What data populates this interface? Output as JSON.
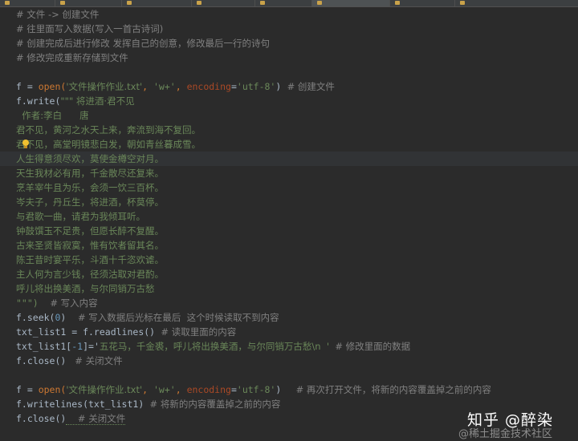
{
  "tabs": [
    "",
    "",
    "",
    "",
    "",
    "",
    "",
    ""
  ],
  "code": {
    "l1": "# 文件 -> 创建文件",
    "l2": "# 往里面写入数据(写入一首古诗词)",
    "l3": "# 创建完成后进行修改 发挥自己的创意，修改最后一行的诗句",
    "l4": "# 修改完成重新存储到文件",
    "l6_var": "f = ",
    "l6_open": "open(",
    "l6_s1": "'文件操作作业.txt'",
    "l6_comma1": ", ",
    "l6_s2": "'w+'",
    "l6_comma2": ", ",
    "l6_kw": "encoding",
    "l6_eq": "=",
    "l6_s3": "'utf-8'",
    "l6_close": ")",
    "l6_comment": "  # 创建文件",
    "l7_code": "f.write(",
    "l7_str": "\"\"\" 将进酒·君不见",
    "l8": "  作者:李白      唐",
    "l9": "君不见，黄河之水天上来，奔流到海不复回。",
    "l10": "君不见，高堂明镜悲白发，朝如青丝暮成雪。",
    "l11": "人生得意须尽欢，莫使金樽空对月。",
    "l12": "天生我材必有用，千金散尽还复来。",
    "l13": "烹羊宰牛且为乐，会须一饮三百杯。",
    "l14": "岑夫子，丹丘生，将进酒，杯莫停。",
    "l15": "与君歌一曲，请君为我倾耳听。",
    "l16": "钟鼓馔玉不足贵，但愿长醉不复醒。",
    "l17": "古来圣贤皆寂寞，惟有饮者留其名。",
    "l18": "陈王昔时宴平乐，斗酒十千恣欢谑。",
    "l19": "主人何为言少钱，径须沽取对君酌。",
    "l20": "呼儿将出换美酒，与尔同销万古愁",
    "l21_str": "\"\"\")",
    "l21_comment": "    # 写入内容",
    "l22_code": "f.seek(",
    "l22_num": "0",
    "l22_close": ")",
    "l22_comment": "    # 写入数据后光标在最后  这个时候读取不到内容",
    "l23_code": "txt_list1 = f.readlines()",
    "l23_comment": "  # 读取里面的内容",
    "l24_code": "txt_list1[",
    "l24_num": "-1",
    "l24_mid": "]='",
    "l24_str": "五花马，千金裘，呼儿将出换美酒，与尔同销万古愁\\n  '",
    "l24_comment": "  # 修改里面的数据",
    "l25_code": "f.close()",
    "l25_comment": "   # 关闭文件",
    "l27_var": "f = ",
    "l27_open": "open(",
    "l27_s1": "'文件操作作业.txt'",
    "l27_comma1": ", ",
    "l27_s2": "'w+'",
    "l27_comma2": ", ",
    "l27_kw": "encoding",
    "l27_eq": "=",
    "l27_s3": "'utf-8'",
    "l27_close": ")",
    "l27_comment": "     # 再次打开文件，将新的内容覆盖掉之前的内容",
    "l28_code": "f.writelines(txt_list1)",
    "l28_comment": "  # 将新的内容覆盖掉之前的内容",
    "l29_code": "f.close()",
    "l29_comment": "    # 关闭文件"
  },
  "watermark": {
    "main": "知乎 @醉染",
    "sub": "@稀土掘金技术社区"
  },
  "colors": {
    "background": "#2b2b2b",
    "comment": "#808080",
    "keyword_orange": "#cc7832",
    "string_green": "#6a8759",
    "number_blue": "#6897bb",
    "kwarg": "#aa4926"
  }
}
